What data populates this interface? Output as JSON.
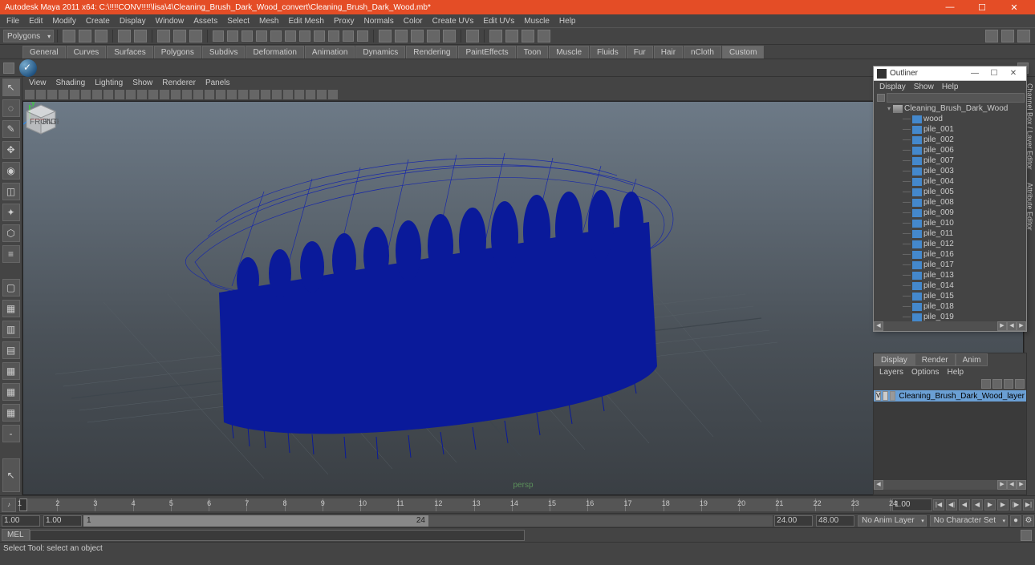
{
  "title": "Autodesk Maya 2011 x64: C:\\!!!!CONV!!!!\\lisa\\4\\Cleaning_Brush_Dark_Wood_convert\\Cleaning_Brush_Dark_Wood.mb*",
  "window_buttons": {
    "min": "—",
    "max": "☐",
    "close": "✕"
  },
  "menu": [
    "File",
    "Edit",
    "Modify",
    "Create",
    "Display",
    "Window",
    "Assets",
    "Select",
    "Mesh",
    "Edit Mesh",
    "Proxy",
    "Normals",
    "Color",
    "Create UVs",
    "Edit UVs",
    "Muscle",
    "Help"
  ],
  "mode_combo": "Polygons",
  "shelf_tabs": [
    "General",
    "Curves",
    "Surfaces",
    "Polygons",
    "Subdivs",
    "Deformation",
    "Animation",
    "Dynamics",
    "Rendering",
    "PaintEffects",
    "Toon",
    "Muscle",
    "Fluids",
    "Fur",
    "Hair",
    "nCloth",
    "Custom"
  ],
  "shelf_active": "Custom",
  "view_menu": [
    "View",
    "Shading",
    "Lighting",
    "Show",
    "Renderer",
    "Panels"
  ],
  "persp_label": "persp",
  "outliner": {
    "title": "Outliner",
    "menu": [
      "Display",
      "Show",
      "Help"
    ],
    "items": [
      {
        "name": "Cleaning_Brush_Dark_Wood",
        "indent": 1,
        "type": "camera",
        "exp": "▾"
      },
      {
        "name": "wood",
        "indent": 2,
        "type": "mesh",
        "exp": ""
      },
      {
        "name": "pile_001",
        "indent": 2,
        "type": "mesh",
        "exp": ""
      },
      {
        "name": "pile_002",
        "indent": 2,
        "type": "mesh",
        "exp": ""
      },
      {
        "name": "pile_006",
        "indent": 2,
        "type": "mesh",
        "exp": ""
      },
      {
        "name": "pile_007",
        "indent": 2,
        "type": "mesh",
        "exp": ""
      },
      {
        "name": "pile_003",
        "indent": 2,
        "type": "mesh",
        "exp": ""
      },
      {
        "name": "pile_004",
        "indent": 2,
        "type": "mesh",
        "exp": ""
      },
      {
        "name": "pile_005",
        "indent": 2,
        "type": "mesh",
        "exp": ""
      },
      {
        "name": "pile_008",
        "indent": 2,
        "type": "mesh",
        "exp": ""
      },
      {
        "name": "pile_009",
        "indent": 2,
        "type": "mesh",
        "exp": ""
      },
      {
        "name": "pile_010",
        "indent": 2,
        "type": "mesh",
        "exp": ""
      },
      {
        "name": "pile_011",
        "indent": 2,
        "type": "mesh",
        "exp": ""
      },
      {
        "name": "pile_012",
        "indent": 2,
        "type": "mesh",
        "exp": ""
      },
      {
        "name": "pile_016",
        "indent": 2,
        "type": "mesh",
        "exp": ""
      },
      {
        "name": "pile_017",
        "indent": 2,
        "type": "mesh",
        "exp": ""
      },
      {
        "name": "pile_013",
        "indent": 2,
        "type": "mesh",
        "exp": ""
      },
      {
        "name": "pile_014",
        "indent": 2,
        "type": "mesh",
        "exp": ""
      },
      {
        "name": "pile_015",
        "indent": 2,
        "type": "mesh",
        "exp": ""
      },
      {
        "name": "pile_018",
        "indent": 2,
        "type": "mesh",
        "exp": ""
      },
      {
        "name": "pile_019",
        "indent": 2,
        "type": "mesh",
        "exp": ""
      }
    ]
  },
  "chbox": {
    "tabs": [
      "Display",
      "Render",
      "Anim"
    ],
    "active_tab": "Display",
    "submenu": [
      "Layers",
      "Options",
      "Help"
    ],
    "layer_v": "V",
    "layer_name": "Cleaning_Brush_Dark_Wood_layer"
  },
  "timeline": {
    "ticks": [
      1,
      2,
      3,
      4,
      5,
      6,
      7,
      8,
      9,
      10,
      11,
      12,
      13,
      14,
      15,
      16,
      17,
      18,
      19,
      20,
      21,
      22,
      23,
      24
    ],
    "cur": "1.00",
    "playback": {
      "gotostart": "|◀",
      "stepback": "◀|",
      "keyback": "◀",
      "play_rev": "◀",
      "play": "▶",
      "keyfwd": "▶",
      "stepfwd": "|▶",
      "gotoend": "▶|"
    }
  },
  "range": {
    "start_out": "1.00",
    "start_in": "1.00",
    "box_start": "1",
    "box_end": "24",
    "end_in": "24.00",
    "end_out": "48.00",
    "anim_layer": "No Anim Layer",
    "char_set": "No Character Set"
  },
  "cmd": {
    "lang": "MEL",
    "input": ""
  },
  "status": "Select Tool: select an object",
  "right_tabs": [
    "Channel Box / Layer Editor",
    "Attribute Editor"
  ]
}
